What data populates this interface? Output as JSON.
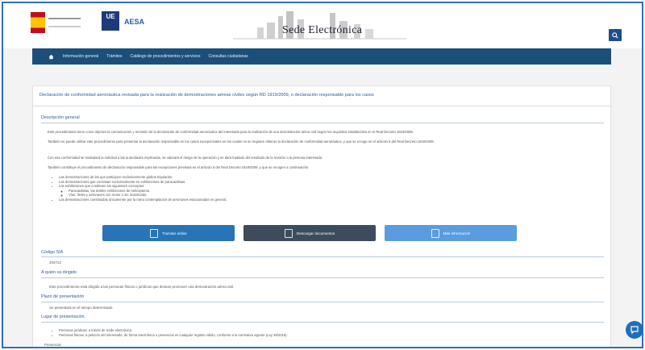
{
  "header": {
    "site_title": "Sede Electrónica",
    "logo_es_alt": "Gobierno de España",
    "logo_ue_text": "UE",
    "logo_aesa_text": "AESA",
    "search_icon": "search-icon"
  },
  "nav": {
    "home_icon": "home-icon",
    "items": [
      "Información general",
      "Trámites",
      "Catálogo de procedimientos y servicios",
      "Consultas ciudadanas"
    ]
  },
  "procedure": {
    "title": "Declaración de conformidad aeronáutica revisada para la realización de demostraciones aéreas civiles según RD 1919/2009, o declaración responsable para los casos"
  },
  "description": {
    "heading": "Descripción general",
    "paragraphs": [
      "Este procedimiento tiene como objetivo la comunicación y remisión de la declaración de conformidad aeronáutica del interesado para la realización de una demostración aérea civil según los requisitos establecidos en el Real Decreto 1919/2009.",
      "También se puede utilizar este procedimiento para presentar la declaración responsable en los casos excepcionales en los cuales no se requiere obtener la declaración de conformidad aeronáutica, y que se recoge en el artículo 5 del Real Decreto 1919/2009.",
      "Con esa conformidad se trasladará la solicitud a las autoridades implicadas, se valorará el riesgo de la operación y se dará traslado del resultado de la revisión a la persona interesada.",
      "También constituye el procedimiento de declaración responsable para las excepciones previstas en el artículo 5 del Real Decreto 1919/2009, y que se recogen a continuación:"
    ],
    "bullets": [
      "Las demostraciones de las que participen exclusivamente globos tripulados.",
      "Las demostraciones que consistan exclusivamente en exhibiciones de paracaidistas.",
      "Las exhibiciones que combinen los siguientes conceptos:",
      "Paracaidistas, las dobles exhibiciones de helicópteros.",
      "Vías, fiesta y aeronaves con motor o sin motorizado.",
      "Las demostraciones constituidas únicamente por la mera contemplación de aeronaves estacionadas en general."
    ]
  },
  "actions": {
    "btn_1": "Tramitar online",
    "btn_2": "Descargar documentos",
    "btn_3": "Más información"
  },
  "sections": {
    "code_heading": "Código SIA",
    "code_value": "204713",
    "audience_heading": "A quién va dirigido",
    "audience_text": "Este procedimiento está dirigido a las personas físicas o jurídicas que desean promover una demostración aérea civil.",
    "deadline_heading": "Plazo de presentación",
    "deadline_text": "Se presentará en el tiempo determinado.",
    "place_heading": "Lugar de presentación",
    "place_bullets": [
      "Personas jurídicas: a través de Sede electrónica.",
      "Personas físicas: a petición del interesado, de forma electrónica o presencial en cualquier registro válido, conforme a la normativa vigente (Ley 39/2015).",
      "Presencial"
    ]
  },
  "chat": {
    "icon": "chat-icon"
  },
  "colors": {
    "frame": "#2f6fbf",
    "nav_bg": "#1b4f7a",
    "btn_primary": "#2874b6",
    "btn_dark": "#3c4c5c",
    "btn_light": "#5b9be0"
  }
}
